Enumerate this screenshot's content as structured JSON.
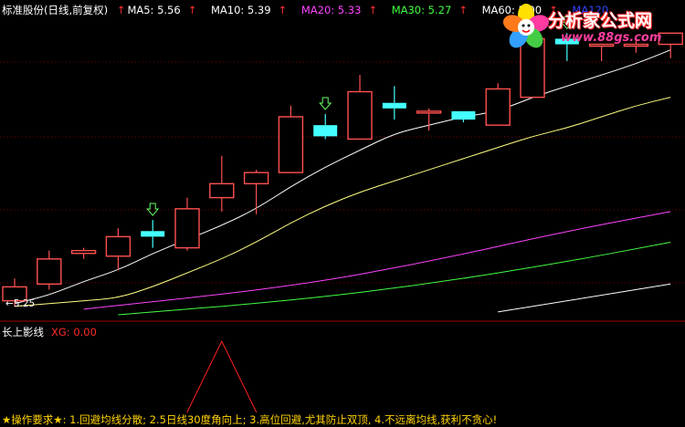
{
  "header": {
    "stock": "标准股份(日线,前复权)",
    "items": [
      {
        "label": "MA5: 5.56",
        "color": "#ffffff"
      },
      {
        "label": "MA10: 5.39",
        "color": "#ffff66"
      },
      {
        "label": "MA20: 5.33",
        "color": "#ff44ff"
      },
      {
        "label": "MA30: 5.27",
        "color": "#44ff44"
      },
      {
        "label": "MA60: 5.00",
        "color": "#ffffff"
      },
      {
        "label": "MA120",
        "color": "#3344ff"
      }
    ]
  },
  "watermark": {
    "title": "分析家公式网",
    "url": "www.88gs.com"
  },
  "price_label": "5.25",
  "sub_indicator": {
    "name": "长上影线",
    "xg_label": "XG: 0.00"
  },
  "footer": "★操作要求★: 1.回避均线分散; 2.5日线30度角向上; 3.高位回避,尤其防止双顶, 4.不远离均线,获利不贪心!",
  "chart_data": {
    "type": "candlestick",
    "colors": {
      "up": "#ff5050",
      "down": "#44ffff",
      "ma5": "#ffffff",
      "ma10": "#ffff80",
      "ma20": "#ff44ff",
      "ma30": "#44ff44",
      "ma60": "#ffffff"
    },
    "candles": [
      {
        "o": 5.25,
        "h": 5.33,
        "l": 5.23,
        "c": 5.3
      },
      {
        "o": 5.31,
        "h": 5.43,
        "l": 5.29,
        "c": 5.4
      },
      {
        "o": 5.42,
        "h": 5.44,
        "l": 5.4,
        "c": 5.43
      },
      {
        "o": 5.41,
        "h": 5.51,
        "l": 5.36,
        "c": 5.48
      },
      {
        "o": 5.5,
        "h": 5.54,
        "l": 5.44,
        "c": 5.48
      },
      {
        "o": 5.44,
        "h": 5.62,
        "l": 5.43,
        "c": 5.58
      },
      {
        "o": 5.62,
        "h": 5.77,
        "l": 5.57,
        "c": 5.67
      },
      {
        "o": 5.67,
        "h": 5.72,
        "l": 5.56,
        "c": 5.71
      },
      {
        "o": 5.71,
        "h": 5.95,
        "l": 5.71,
        "c": 5.91
      },
      {
        "o": 5.88,
        "h": 5.92,
        "l": 5.83,
        "c": 5.84
      },
      {
        "o": 5.83,
        "h": 6.06,
        "l": 5.83,
        "c": 6.0
      },
      {
        "o": 5.96,
        "h": 6.02,
        "l": 5.9,
        "c": 5.94
      },
      {
        "o": 5.93,
        "h": 5.94,
        "l": 5.86,
        "c": 5.93
      },
      {
        "o": 5.93,
        "h": 5.93,
        "l": 5.89,
        "c": 5.9
      },
      {
        "o": 5.88,
        "h": 6.03,
        "l": 5.88,
        "c": 6.01
      },
      {
        "o": 5.98,
        "h": 6.21,
        "l": 5.98,
        "c": 6.19
      },
      {
        "o": 6.19,
        "h": 6.21,
        "l": 6.11,
        "c": 6.17
      },
      {
        "o": 6.17,
        "h": 6.17,
        "l": 6.11,
        "c": 6.17
      },
      {
        "o": 6.17,
        "h": 6.19,
        "l": 6.14,
        "c": 6.17
      },
      {
        "o": 6.17,
        "h": 6.21,
        "l": 6.12,
        "c": 6.21
      }
    ],
    "ma5": [
      5.24,
      5.27,
      5.32,
      5.36,
      5.42,
      5.47,
      5.52,
      5.58,
      5.66,
      5.73,
      5.79,
      5.85,
      5.88,
      5.91,
      5.93,
      5.98,
      6.02,
      6.06,
      6.1,
      6.15
    ],
    "ma10": [
      5.23,
      5.24,
      5.25,
      5.26,
      5.3,
      5.35,
      5.4,
      5.46,
      5.53,
      5.59,
      5.64,
      5.68,
      5.72,
      5.76,
      5.8,
      5.84,
      5.87,
      5.91,
      5.95,
      5.98
    ],
    "ma20_pts": [
      [
        2,
        5.22
      ],
      [
        8,
        5.3
      ],
      [
        12,
        5.39
      ],
      [
        16,
        5.5
      ],
      [
        19,
        5.57
      ]
    ],
    "ma30_pts": [
      [
        3,
        5.2
      ],
      [
        8,
        5.25
      ],
      [
        12,
        5.31
      ],
      [
        16,
        5.39
      ],
      [
        19,
        5.46
      ]
    ],
    "ma60_pts": [
      [
        14,
        5.21
      ],
      [
        19,
        5.31
      ]
    ],
    "signal_arrows": [
      4,
      9,
      16
    ],
    "sub_peak_index": 6,
    "ylim": [
      5.19,
      6.27
    ]
  }
}
